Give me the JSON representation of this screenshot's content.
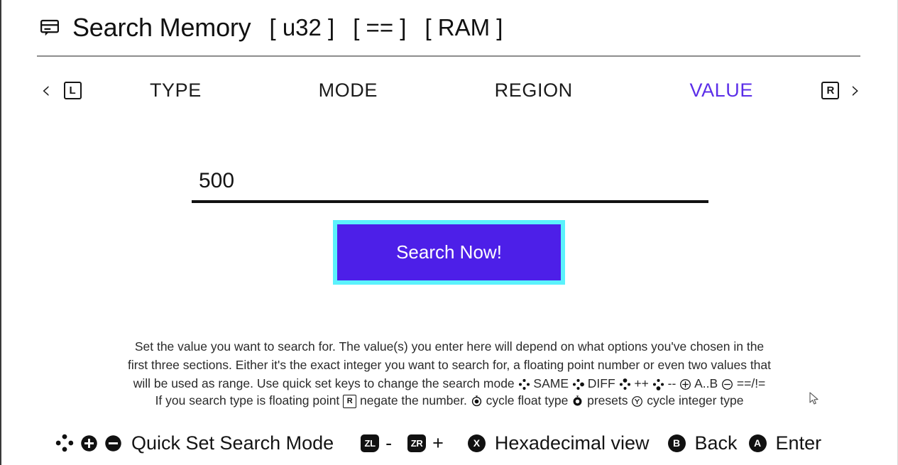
{
  "window": {
    "title": "Search Memory",
    "icon": "message-bubble-icon",
    "tags": [
      "[ u32 ]",
      "[ == ]",
      "[ RAM ]"
    ]
  },
  "tabbar": {
    "prev_chevron": "‹",
    "next_chevron": "›",
    "left_shoulder": "L",
    "right_shoulder": "R",
    "tabs": [
      {
        "label": "TYPE",
        "active": false
      },
      {
        "label": "MODE",
        "active": false
      },
      {
        "label": "REGION",
        "active": false
      },
      {
        "label": "VALUE",
        "active": true
      }
    ],
    "active_color": "#5B2EE8"
  },
  "value_input": {
    "value": "500",
    "placeholder": ""
  },
  "search_button": {
    "label": "Search Now!",
    "fill_color": "#4D1FE8",
    "border_color": "#5BF2FC",
    "text_color": "#FFFFFF"
  },
  "help": {
    "line1": "Set the value you want to search for. The value(s) you enter here will depend on what options you've chosen in the",
    "line2": "first three sections. Either it's the exact integer you want to search for, a floating point number or even two values that",
    "line3_a": "will be used as range. Use quick set keys to change the search mode",
    "line3_same": "SAME",
    "line3_diff": "DIFF",
    "line3_plusplus": "++",
    "line3_minusminus": "--",
    "line3_ab": "A..B",
    "line3_eqneq": "==/!=",
    "line4_a": "If you search type is floating point",
    "line4_rkey": "R",
    "line4_b": "negate the number.",
    "line4_c": "cycle float type",
    "line4_d": "presets",
    "line4_e": "cycle integer type",
    "line4_y": "Y"
  },
  "bottombar": {
    "quick_set_label": "Quick Set Search Mode",
    "zl_key": "ZL",
    "zl_sign": "-",
    "zr_key": "ZR",
    "zr_sign": "+",
    "x_key": "X",
    "hex_label": "Hexadecimal view",
    "b_key": "B",
    "back_label": "Back",
    "a_key": "A",
    "enter_label": "Enter"
  }
}
